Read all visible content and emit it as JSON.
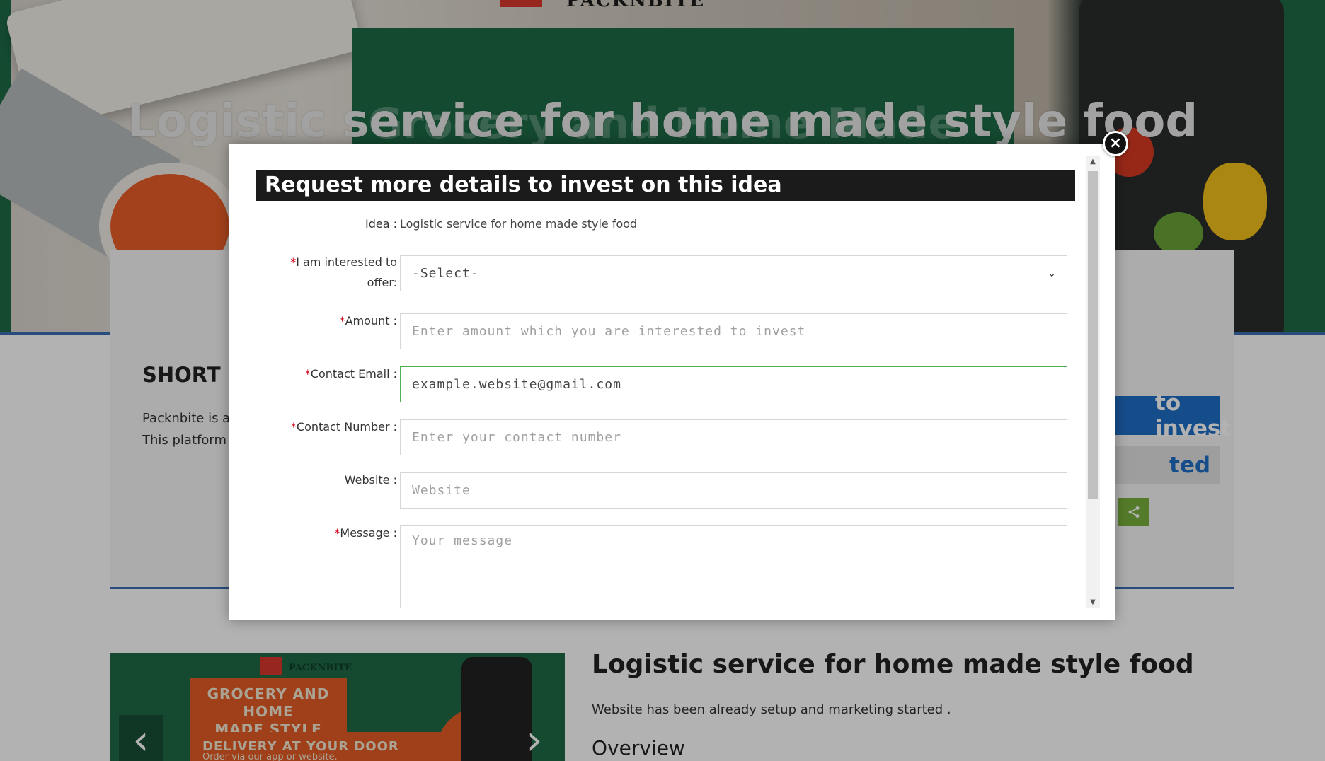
{
  "page": {
    "brand": "PACKNBITE",
    "hero_title": "Logistic service for home made style food",
    "hero_subtitle": "Grocery and Home Made",
    "short_heading": "SHORT S",
    "short_text": "Packnbite is a",
    "short_text_2": "This platform",
    "invest_button": "to invest",
    "interested_button": "ted",
    "share_icon": "share-icon",
    "detail_title": "Logistic service for home made style food",
    "detail_text": "Website has been already setup and marketing started .",
    "overview_heading": "Overview",
    "slider": {
      "brand": "PACKNBITE",
      "promo_line_1": "GROCERY AND HOME",
      "promo_line_2": "MADE STYLE",
      "promo_line_3": "DELIVERY AT YOUR DOOR",
      "promo_line_4": "Order via our app or website.",
      "prev_icon": "chevron-left-icon",
      "next_icon": "chevron-right-icon"
    }
  },
  "modal": {
    "title": "Request more details to invest on this idea",
    "close_icon": "close-icon",
    "fields": {
      "idea": {
        "label": "Idea :",
        "value": "Logistic service for home made style food"
      },
      "offer": {
        "required": "*",
        "label": "I am interested to offer:",
        "selected": "-Select-"
      },
      "amount": {
        "required": "*",
        "label": "Amount :",
        "placeholder": "Enter amount which you are interested to invest"
      },
      "email": {
        "required": "*",
        "label": "Contact Email :",
        "value": "example.website@gmail.com"
      },
      "phone": {
        "required": "*",
        "label": "Contact Number :",
        "placeholder": "Enter your contact number"
      },
      "website": {
        "label": "Website :",
        "placeholder": "Website"
      },
      "message": {
        "required": "*",
        "label": "Message :",
        "placeholder": "Your message"
      }
    }
  },
  "colors": {
    "modal_title_bg": "#1b1b1b",
    "required": "#d0021b",
    "focus_border": "#4caf50",
    "primary_button": "#1f6fc8",
    "brand_green": "#1f6b47"
  }
}
